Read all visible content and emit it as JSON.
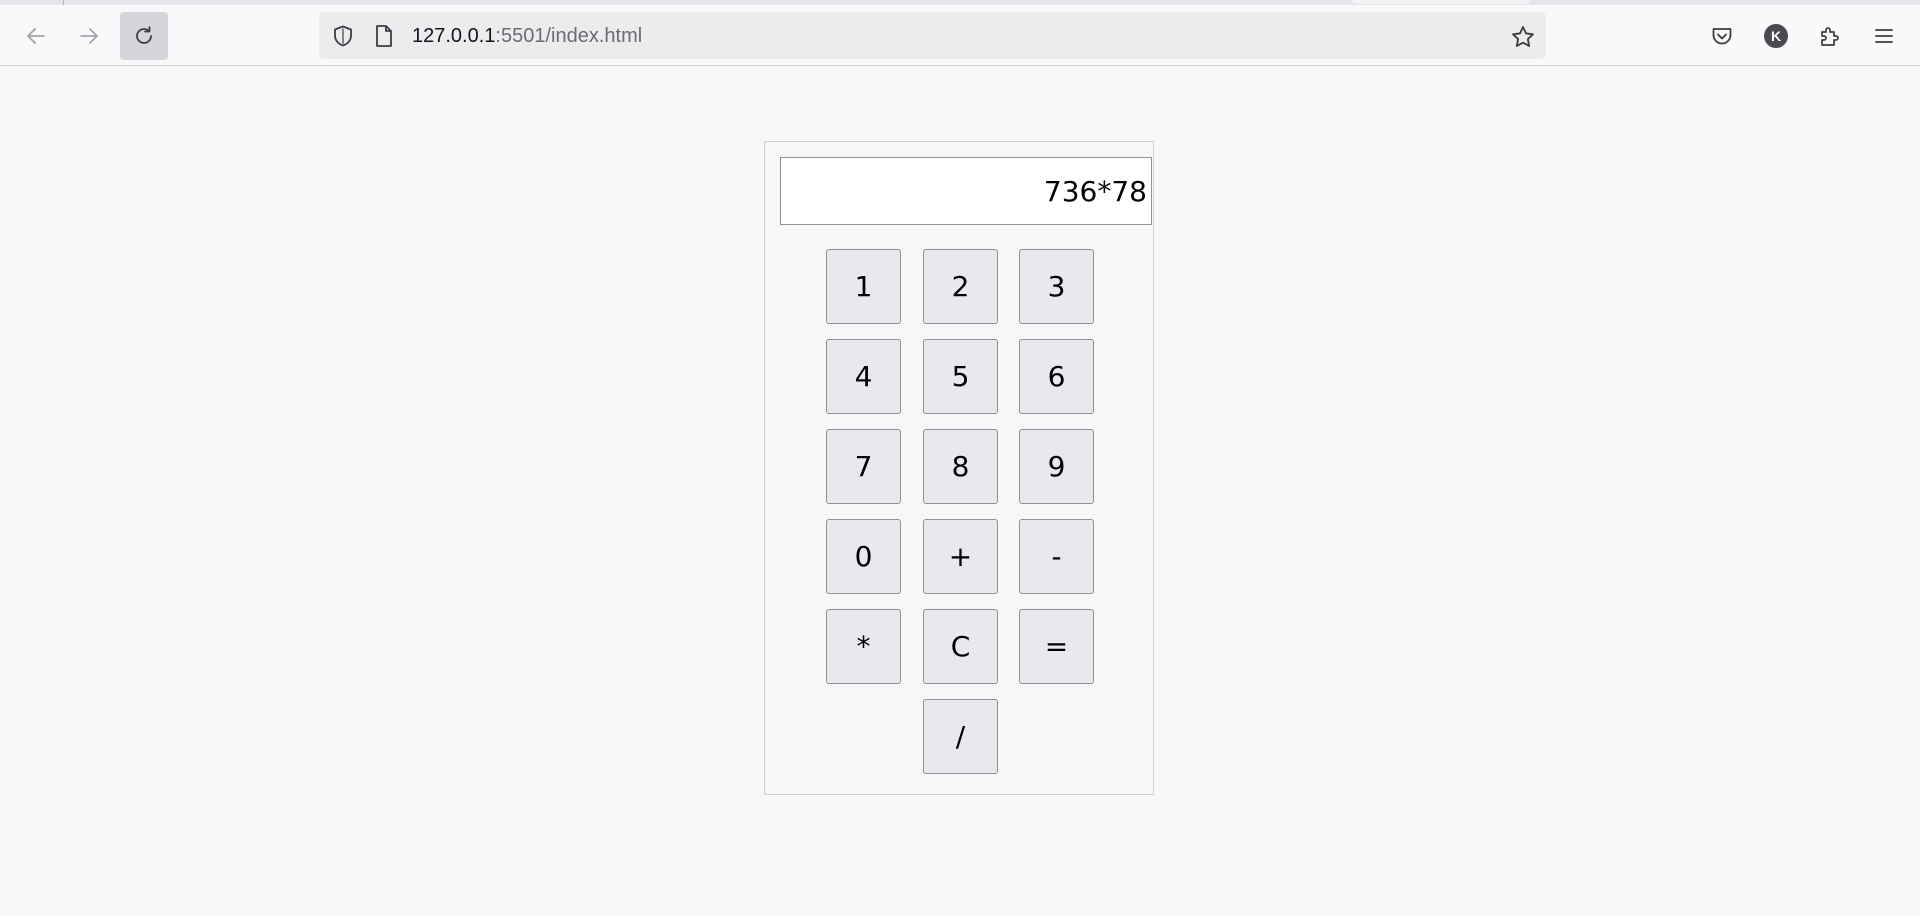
{
  "browser": {
    "url_host": "127.0.0.1",
    "url_rest": ":5501/index.html",
    "account_initial": "K"
  },
  "calculator": {
    "display_value": "736*78",
    "keys": [
      "1",
      "2",
      "3",
      "4",
      "5",
      "6",
      "7",
      "8",
      "9",
      "0",
      "+",
      "-",
      "*",
      "C",
      "=",
      "/"
    ]
  },
  "icons": {
    "back": "arrow-left-icon",
    "forward": "arrow-right-icon",
    "reload": "reload-icon",
    "shield": "shield-icon",
    "page": "page-icon",
    "bookmark": "star-icon",
    "pocket": "pocket-icon",
    "account": "account-avatar",
    "extensions": "puzzle-icon",
    "menu": "hamburger-icon"
  },
  "colors": {
    "page_background": "#f7f7f7",
    "key_background": "#e9e9ed",
    "key_border": "#8f8f9d",
    "display_background": "#ffffff"
  }
}
